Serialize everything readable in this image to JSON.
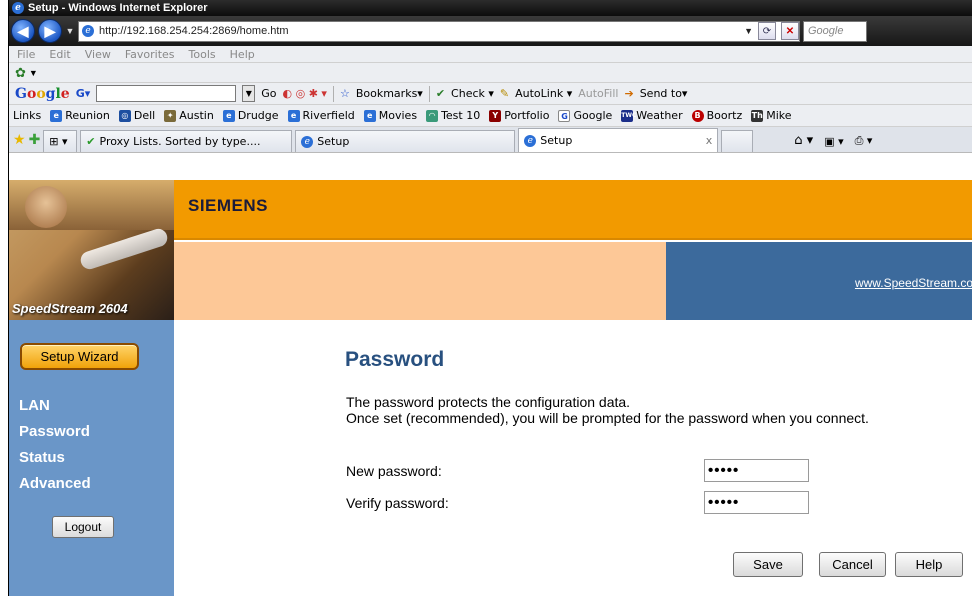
{
  "window": {
    "title": "Setup - Windows Internet Explorer"
  },
  "address": {
    "url": "http://192.168.254.254:2869/home.htm",
    "search_placeholder": "Google"
  },
  "menu": [
    "File",
    "Edit",
    "View",
    "Favorites",
    "Tools",
    "Help"
  ],
  "google_toolbar": {
    "go": "Go",
    "bookmarks": "Bookmarks▾",
    "check": "Check ▾",
    "autolink": "AutoLink ▾",
    "autofill": "AutoFill",
    "sendto": "Send to▾"
  },
  "links_bar": {
    "label": "Links",
    "items": [
      "Reunion",
      "Dell",
      "Austin",
      "Drudge",
      "Riverfield",
      "Movies",
      "Test 10",
      "Portfolio",
      "Google",
      "Weather",
      "Boortz",
      "Mike"
    ]
  },
  "tabs": [
    {
      "label": "Proxy Lists. Sorted by type...."
    },
    {
      "label": "Setup"
    },
    {
      "label": "Setup"
    }
  ],
  "header": {
    "brand": "SIEMENS",
    "product": "SpeedStream 2604",
    "site_link": "www.SpeedStream.com"
  },
  "sidebar": {
    "wizard": "Setup Wizard",
    "items": [
      "LAN",
      "Password",
      "Status",
      "Advanced"
    ],
    "logout": "Logout"
  },
  "main": {
    "title": "Password",
    "desc_line1": "The password protects the configuration data.",
    "desc_line2": "Once set (recommended), you will be prompted for the password when you connect.",
    "new_label": "New password:",
    "new_value": "•••••",
    "verify_label": "Verify password:",
    "verify_value": "•••••",
    "save": "Save",
    "cancel": "Cancel",
    "help": "Help"
  }
}
